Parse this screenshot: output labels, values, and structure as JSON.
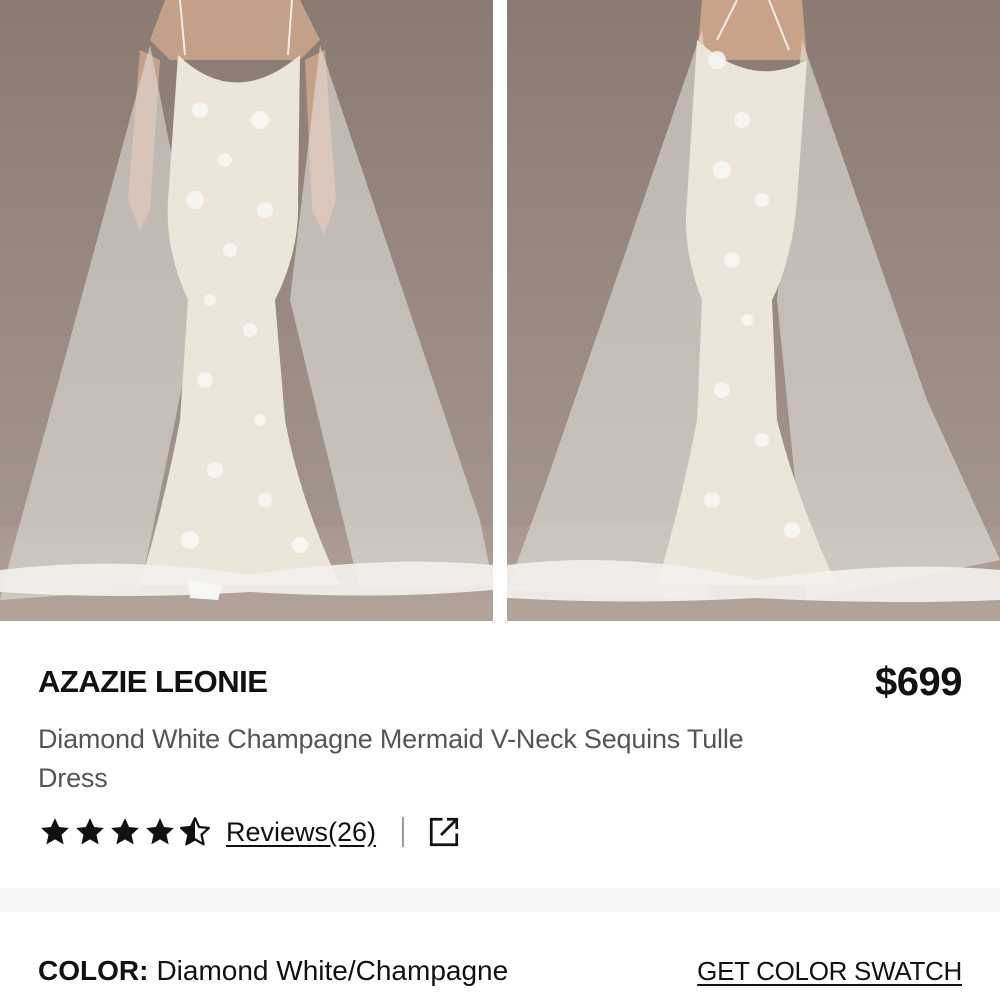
{
  "gallery": {
    "images": [
      {
        "alt": "",
        "view": "front"
      },
      {
        "alt": "",
        "view": "back"
      }
    ]
  },
  "product": {
    "brand": "AZAZIE LEONIE",
    "price": "$699",
    "name": "Diamond White Champagne Mermaid V-Neck Sequins Tulle Dress",
    "rating": 4.5,
    "rating_max": 5,
    "reviews_label": "Reviews(26)"
  },
  "icons": {
    "star": "star-icon",
    "share": "share-external-link-icon"
  },
  "color": {
    "label": "COLOR:",
    "value": "Diamond White/Champagne",
    "swatch_link": "GET COLOR SWATCH"
  },
  "colors": {
    "text": "#111111",
    "subtext": "#555555",
    "backdrop": "#978980",
    "separator": "#f5f5f5"
  }
}
